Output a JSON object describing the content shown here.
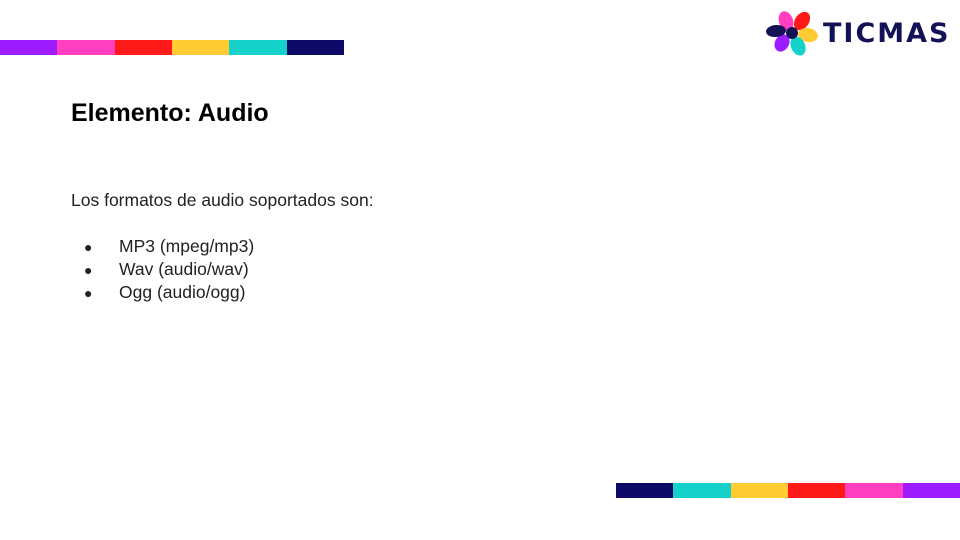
{
  "brand": {
    "name": "TICMAS",
    "logo_icon": "pinwheel-logo-icon",
    "colors": {
      "navy": "#141257",
      "pink": "#ff3fc0",
      "red": "#ff1a1a",
      "yellow": "#ffcc33",
      "teal": "#14d1c9",
      "purple": "#9c1cff"
    }
  },
  "stripes": {
    "top": [
      "#9c1cff",
      "#ff3fc0",
      "#ff1a1a",
      "#ffcc33",
      "#14d1c9",
      "#0c0a66"
    ],
    "bottom": [
      "#0c0a66",
      "#14d1c9",
      "#ffcc33",
      "#ff1a1a",
      "#ff3fc0",
      "#9c1cff"
    ]
  },
  "slide": {
    "title": "Elemento: Audio",
    "intro": "Los formatos de audio soportados son:",
    "formats": [
      {
        "bullet": "●",
        "text": "MP3 (mpeg/mp3)"
      },
      {
        "bullet": "●",
        "text": "Wav (audio/wav)"
      },
      {
        "bullet": "●",
        "text": "Ogg (audio/ogg)"
      }
    ]
  }
}
